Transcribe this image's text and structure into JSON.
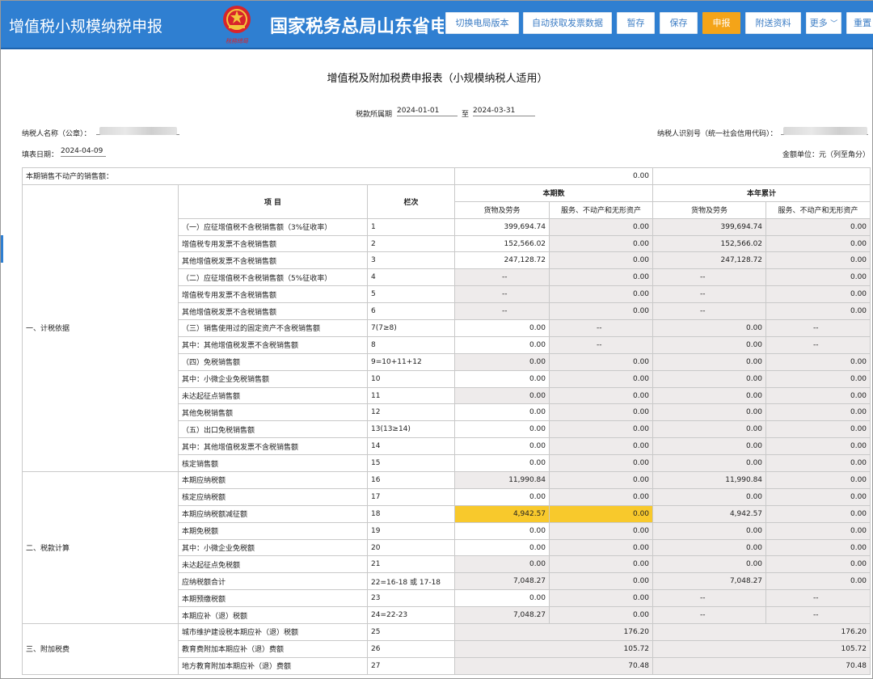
{
  "header": {
    "app_title": "增值税小规模纳税申报",
    "emblem_caption": "稅務總局",
    "bureau_name": "国家税务总局山东省电子税务局",
    "buttons": {
      "switch_version": "切换电局版本",
      "auto_fetch": "自动获取发票数据",
      "temp_save": "暂存",
      "save": "保存",
      "declare": "申报",
      "attachments": "附送资料",
      "more": "更多",
      "reset": "重置"
    }
  },
  "form": {
    "title": "增值税及附加税费申报表（小规模纳税人适用）",
    "period_label": "税款所属期",
    "period_from": "2024-01-01",
    "period_to_label": "至",
    "period_to": "2024-03-31",
    "taxpayer_name_label": "纳税人名称（公章）：",
    "taxpayer_id_label": "纳税人识别号（统一社会信用代码）：",
    "fill_date_label": "填表日期：",
    "fill_date": "2024-04-09",
    "unit_label": "金额单位：元（列至角分）"
  },
  "table": {
    "top_row": {
      "label": "本期销售不动产的销售额：",
      "value": "0.00"
    },
    "headers": {
      "item": "项  目",
      "line": "栏次",
      "current": "本期数",
      "ytd": "本年累计",
      "goods": "货物及劳务",
      "services": "服务、不动产和无形资产"
    },
    "sections": {
      "s1": "一、计税依据",
      "s2": "二、税款计算",
      "s3": "三、附加税费"
    },
    "rows": [
      {
        "item": "（一）应征增值税不含税销售额（3%征收率）",
        "line": "1",
        "c1": "399,694.74",
        "c2": "0.00",
        "c3": "399,694.74",
        "c4": "0.00"
      },
      {
        "item": "增值税专用发票不含税销售额",
        "line": "2",
        "c1": "152,566.02",
        "c2": "0.00",
        "c3": "152,566.02",
        "c4": "0.00"
      },
      {
        "item": "其他增值税发票不含税销售额",
        "line": "3",
        "c1": "247,128.72",
        "c2": "0.00",
        "c3": "247,128.72",
        "c4": "0.00"
      },
      {
        "item": "（二）应征增值税不含税销售额（5%征收率）",
        "line": "4",
        "c1": "--",
        "c2": "0.00",
        "c3": "--",
        "c4": "0.00"
      },
      {
        "item": "增值税专用发票不含税销售额",
        "line": "5",
        "c1": "--",
        "c2": "0.00",
        "c3": "--",
        "c4": "0.00"
      },
      {
        "item": "其他增值税发票不含税销售额",
        "line": "6",
        "c1": "--",
        "c2": "0.00",
        "c3": "--",
        "c4": "0.00"
      },
      {
        "item": "（三）销售使用过的固定资产不含税销售额",
        "line": "7(7≥8)",
        "c1": "0.00",
        "c2": "--",
        "c3": "0.00",
        "c4": "--"
      },
      {
        "item": "其中：其他增值税发票不含税销售额",
        "line": "8",
        "c1": "0.00",
        "c2": "--",
        "c3": "0.00",
        "c4": "--"
      },
      {
        "item": "（四）免税销售额",
        "line": "9=10+11+12",
        "c1": "0.00",
        "c2": "0.00",
        "c3": "0.00",
        "c4": "0.00"
      },
      {
        "item": "其中：小微企业免税销售额",
        "line": "10",
        "c1": "0.00",
        "c2": "0.00",
        "c3": "0.00",
        "c4": "0.00"
      },
      {
        "item": "未达起征点销售额",
        "line": "11",
        "c1": "0.00",
        "c2": "0.00",
        "c3": "0.00",
        "c4": "0.00"
      },
      {
        "item": "其他免税销售额",
        "line": "12",
        "c1": "0.00",
        "c2": "0.00",
        "c3": "0.00",
        "c4": "0.00"
      },
      {
        "item": "（五）出口免税销售额",
        "line": "13(13≥14)",
        "c1": "0.00",
        "c2": "0.00",
        "c3": "0.00",
        "c4": "0.00"
      },
      {
        "item": "其中：其他增值税发票不含税销售额",
        "line": "14",
        "c1": "0.00",
        "c2": "0.00",
        "c3": "0.00",
        "c4": "0.00"
      },
      {
        "item": "核定销售额",
        "line": "15",
        "c1": "0.00",
        "c2": "0.00",
        "c3": "0.00",
        "c4": "0.00"
      },
      {
        "item": "本期应纳税额",
        "line": "16",
        "c1": "11,990.84",
        "c2": "0.00",
        "c3": "11,990.84",
        "c4": "0.00"
      },
      {
        "item": "核定应纳税额",
        "line": "17",
        "c1": "0.00",
        "c2": "0.00",
        "c3": "0.00",
        "c4": "0.00"
      },
      {
        "item": "本期应纳税额减征额",
        "line": "18",
        "c1": "4,942.57",
        "c2": "0.00",
        "c3": "4,942.57",
        "c4": "0.00"
      },
      {
        "item": "本期免税额",
        "line": "19",
        "c1": "0.00",
        "c2": "0.00",
        "c3": "0.00",
        "c4": "0.00"
      },
      {
        "item": "其中：小微企业免税额",
        "line": "20",
        "c1": "0.00",
        "c2": "0.00",
        "c3": "0.00",
        "c4": "0.00"
      },
      {
        "item": "未达起征点免税额",
        "line": "21",
        "c1": "0.00",
        "c2": "0.00",
        "c3": "0.00",
        "c4": "0.00"
      },
      {
        "item": "应纳税额合计",
        "line": "22=16-18 或 17-18",
        "c1": "7,048.27",
        "c2": "0.00",
        "c3": "7,048.27",
        "c4": "0.00"
      },
      {
        "item": "本期预缴税额",
        "line": "23",
        "c1": "0.00",
        "c2": "0.00",
        "c3": "--",
        "c4": "--"
      },
      {
        "item": "本期应补（退）税额",
        "line": "24=22-23",
        "c1": "7,048.27",
        "c2": "0.00",
        "c3": "--",
        "c4": "--"
      },
      {
        "item": "城市维护建设税本期应补（退）税额",
        "line": "25",
        "v1": "176.20",
        "v2": "176.20"
      },
      {
        "item": "教育费附加本期应补（退）费额",
        "line": "26",
        "v1": "105.72",
        "v2": "105.72"
      },
      {
        "item": "地方教育附加本期应补（退）费额",
        "line": "27",
        "v1": "70.48",
        "v2": "70.48"
      }
    ]
  }
}
